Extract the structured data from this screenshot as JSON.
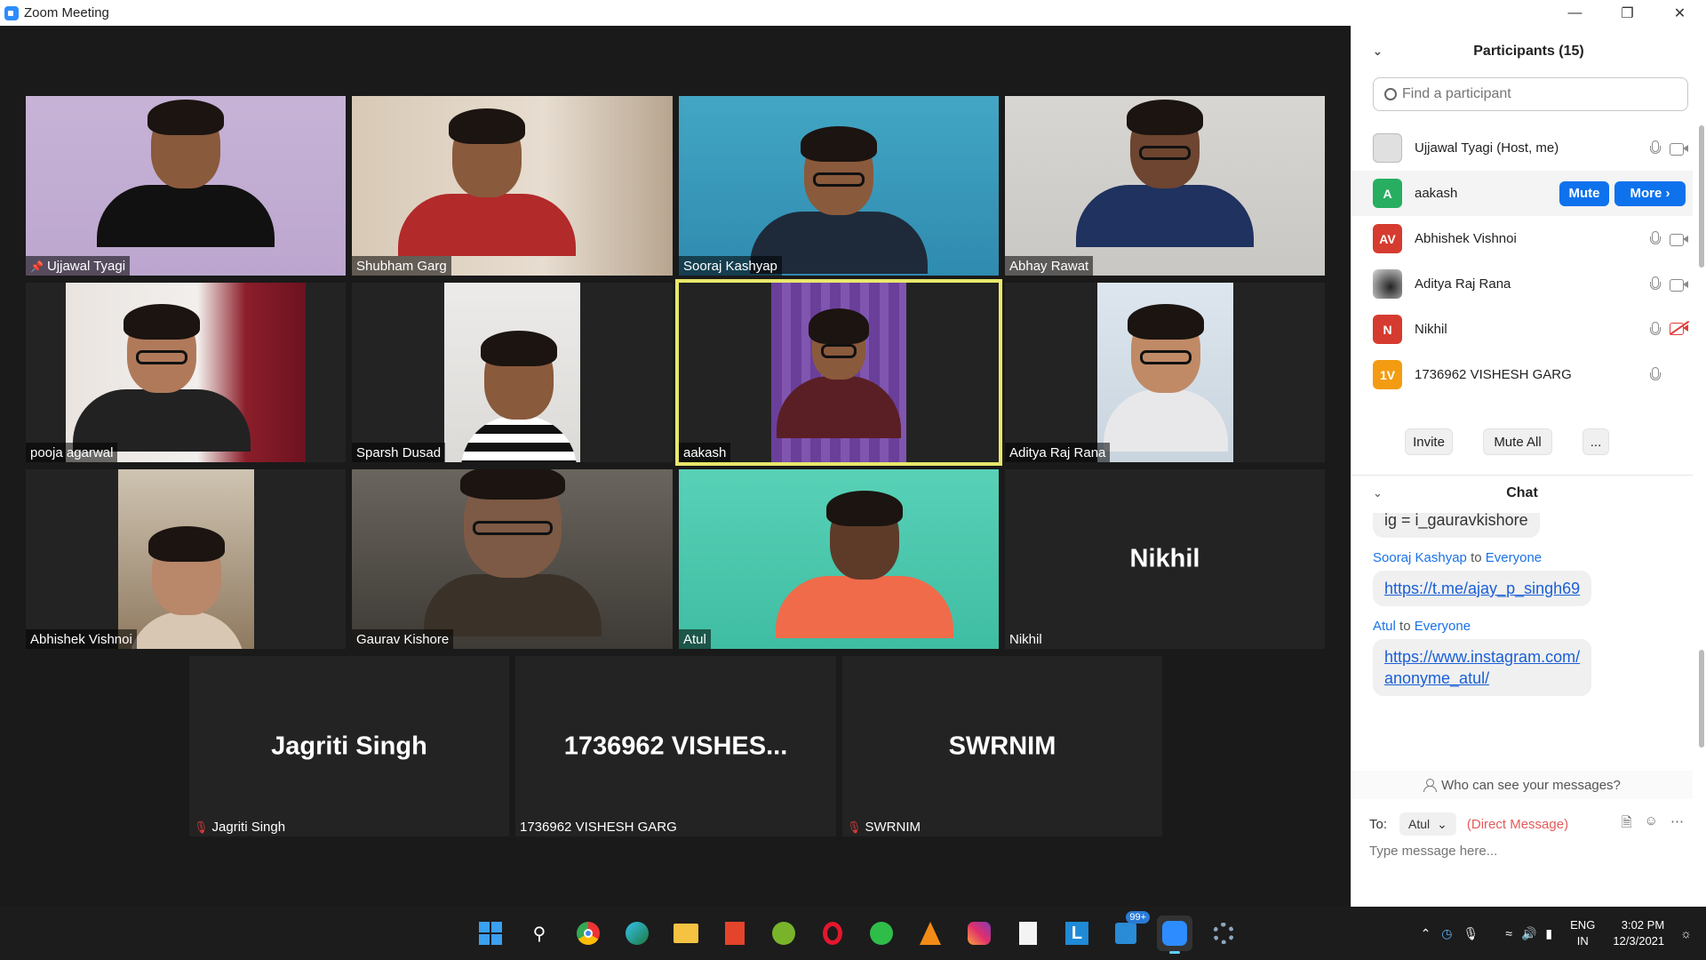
{
  "window": {
    "title": "Zoom Meeting"
  },
  "tiles": [
    {
      "name": "Ujjawal Tyagi",
      "pinned": true
    },
    {
      "name": "Shubham Garg"
    },
    {
      "name": "Sooraj Kashyap"
    },
    {
      "name": "Abhay Rawat"
    },
    {
      "name": "pooja agarwal"
    },
    {
      "name": "Sparsh Dusad"
    },
    {
      "name": "aakash",
      "speaking": true
    },
    {
      "name": "Aditya Raj Rana"
    },
    {
      "name": "Abhishek Vishnoi"
    },
    {
      "name": "Gaurav Kishore"
    },
    {
      "name": "Atul"
    },
    {
      "name": "Nikhil",
      "display": "Nikhil",
      "video": false
    },
    {
      "name": "Jagriti Singh",
      "display": "Jagriti Singh",
      "video": false,
      "muted": true
    },
    {
      "name": "1736962 VISHESH GARG",
      "display": "1736962  VISHES...",
      "video": false
    },
    {
      "name": "SWRNIM",
      "display": "SWRNIM",
      "video": false,
      "muted": true
    }
  ],
  "participants_panel": {
    "title": "Participants (15)",
    "search_placeholder": "Find a participant",
    "list": [
      {
        "name": "Ujjawal Tyagi (Host, me)",
        "avatar": "",
        "avatar_color": "#cfcfcf"
      },
      {
        "name": "aakash",
        "avatar": "A",
        "avatar_color": "#27ae60"
      },
      {
        "name": "Abhishek Vishnoi",
        "avatar": "AV",
        "avatar_color": "#d63b2f"
      },
      {
        "name": "Aditya Raj Rana",
        "avatar": "",
        "avatar_color": "#555555"
      },
      {
        "name": "Nikhil",
        "avatar": "N",
        "avatar_color": "#d63b2f"
      },
      {
        "name": "1736962 VISHESH GARG",
        "avatar": "1V",
        "avatar_color": "#f39c12"
      }
    ],
    "mute_label": "Mute",
    "more_label": "More",
    "invite_label": "Invite",
    "mute_all_label": "Mute All",
    "overflow_label": "..."
  },
  "chat": {
    "title": "Chat",
    "messages": [
      {
        "text": "ig = i_gauravkishore"
      },
      {
        "from": "Sooraj Kashyap",
        "to": "Everyone",
        "text": "https://t.me/ajay_p_singh69"
      },
      {
        "from": "Atul",
        "to": "Everyone",
        "line1": "https://www.instagram.com/",
        "line2": "anonyme_atul/"
      }
    ],
    "to_word": "to",
    "who_can_see": "Who can see your messages?",
    "to_label": "To:",
    "recipient": "Atul",
    "direct_message": "(Direct Message)",
    "input_placeholder": "Type message here..."
  },
  "taskbar": {
    "badge": "99+",
    "lang_top": "ENG",
    "lang_bottom": "IN",
    "time": "3:02 PM",
    "date": "12/3/2021"
  },
  "colors": {
    "accent": "#0e72ed",
    "active_speaker": "#e8e86a",
    "muted": "#e23b3b"
  }
}
